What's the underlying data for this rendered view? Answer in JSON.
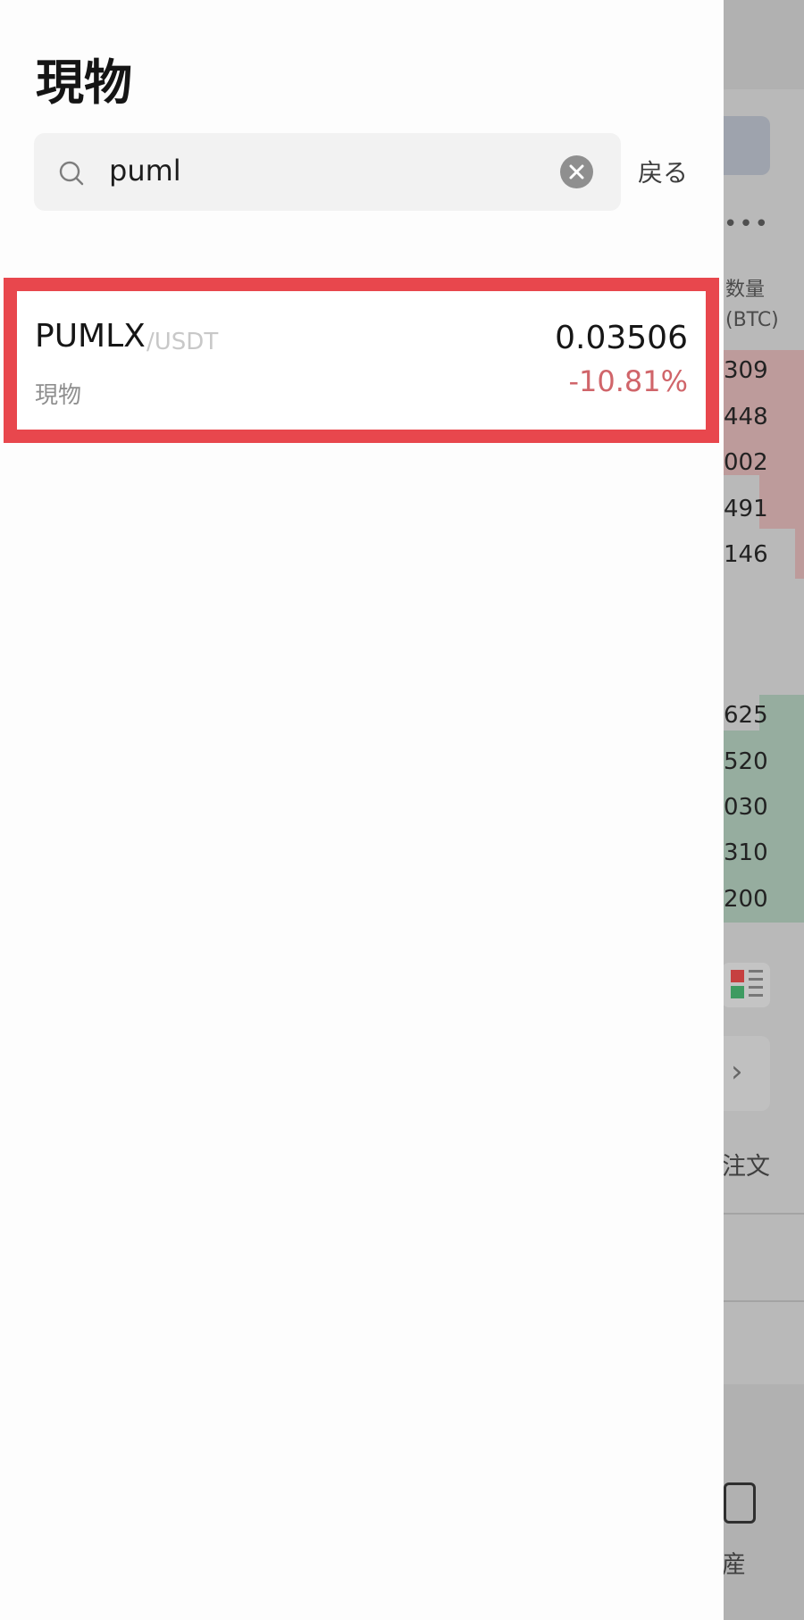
{
  "page": {
    "title": "現物"
  },
  "search": {
    "value": "puml",
    "placeholder": "",
    "back_label": "戻る"
  },
  "results": [
    {
      "base": "PUMLX",
      "quote": "/USDT",
      "market": "現物",
      "price": "0.03506",
      "change": "-10.81%"
    }
  ],
  "background": {
    "more_dots": "•••",
    "header_quantity": "数量",
    "header_unit": "(BTC)",
    "sell_amounts": [
      "309",
      "448",
      "002",
      "491",
      "146"
    ],
    "buy_amounts": [
      "625",
      "520",
      "030",
      "310",
      "200"
    ],
    "order_tab": "注文",
    "nav_asset": "産",
    "arrow_glyph": "›"
  },
  "colors": {
    "highlight": "#e8474d",
    "negative": "#d0656a",
    "drawer_bg": "#fdfdfd",
    "overlay": "#b1b1b1"
  }
}
